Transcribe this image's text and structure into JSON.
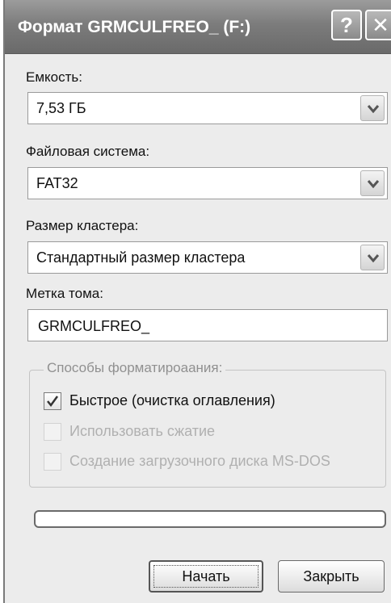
{
  "window": {
    "title": "Формат GRMCULFREO_ (F:)",
    "help_glyph": "?",
    "close_glyph": "✕"
  },
  "capacity": {
    "label": "Емкость:",
    "value": "7,53 ГБ"
  },
  "filesystem": {
    "label": "Файловая система:",
    "value": "FAT32"
  },
  "cluster_size": {
    "label": "Размер кластера:",
    "value": "Стандартный размер кластера"
  },
  "volume_label": {
    "label": "Метка тома:",
    "value": "GRMCULFREO_"
  },
  "format_options": {
    "legend": "Способы форматироаания:",
    "quick": {
      "label": "Быстрое (очистка оглавления)",
      "checked": true,
      "enabled": true
    },
    "compression": {
      "label": "Использовать сжатие",
      "checked": false,
      "enabled": false
    },
    "msdos_boot": {
      "label": "Создание загрузочного диска MS-DOS",
      "checked": false,
      "enabled": false
    }
  },
  "progress": {
    "fraction": 0
  },
  "buttons": {
    "start": "Начать",
    "close": "Закрыть"
  },
  "colors": {
    "titlebar": "#7c7c7c",
    "dialog_background": "#ececec",
    "disabled_text": "#b0b0b0"
  },
  "icons": {
    "dropdown": "chevron-down-icon",
    "check": "check-icon",
    "help": "help-icon",
    "close": "close-icon"
  }
}
